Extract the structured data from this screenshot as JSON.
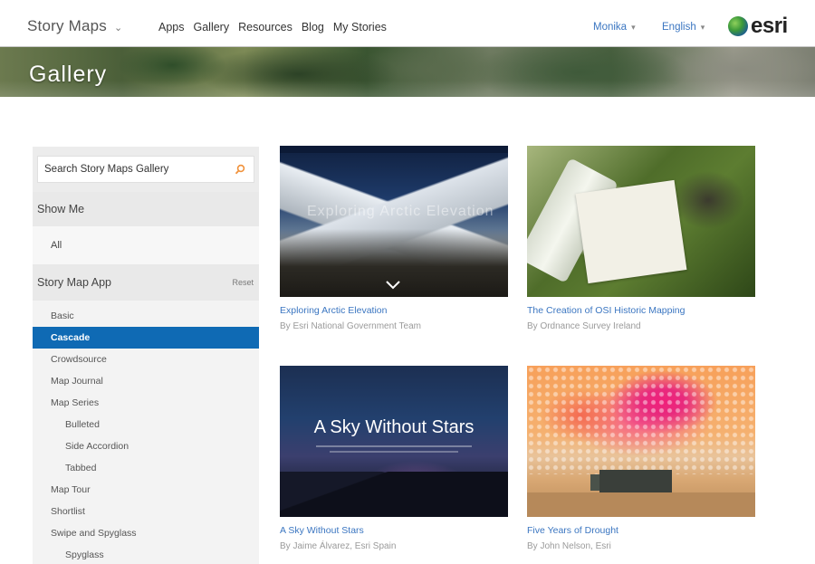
{
  "header": {
    "brand": "Story Maps",
    "nav": [
      "Apps",
      "Gallery",
      "Resources",
      "Blog",
      "My Stories"
    ],
    "user": "Monika",
    "language": "English",
    "logo_text": "esri"
  },
  "banner": {
    "title": "Gallery"
  },
  "sidebar": {
    "search_placeholder": "Search Story Maps Gallery",
    "show_me": "Show Me",
    "all": "All",
    "app_section": "Story Map App",
    "reset": "Reset",
    "apps": [
      {
        "label": "Basic",
        "level": 0,
        "active": false
      },
      {
        "label": "Cascade",
        "level": 0,
        "active": true
      },
      {
        "label": "Crowdsource",
        "level": 0,
        "active": false
      },
      {
        "label": "Map Journal",
        "level": 0,
        "active": false
      },
      {
        "label": "Map Series",
        "level": 0,
        "active": false
      },
      {
        "label": "Bulleted",
        "level": 1,
        "active": false
      },
      {
        "label": "Side Accordion",
        "level": 1,
        "active": false
      },
      {
        "label": "Tabbed",
        "level": 1,
        "active": false
      },
      {
        "label": "Map Tour",
        "level": 0,
        "active": false
      },
      {
        "label": "Shortlist",
        "level": 0,
        "active": false
      },
      {
        "label": "Swipe and Spyglass",
        "level": 0,
        "active": false
      },
      {
        "label": "Spyglass",
        "level": 1,
        "active": false
      }
    ]
  },
  "cards": [
    {
      "title": "Exploring Arctic Elevation",
      "author": "By Esri National Government Team",
      "thumb_text": "Exploring Arctic Elevation"
    },
    {
      "title": "The Creation of OSI Historic Mapping",
      "author": "By Ordnance Survey Ireland"
    },
    {
      "title": "A Sky Without Stars",
      "author": "By Jaime Álvarez, Esri Spain",
      "thumb_text": "A Sky Without Stars"
    },
    {
      "title": "Five Years of Drought",
      "author": "By John Nelson, Esri"
    }
  ]
}
